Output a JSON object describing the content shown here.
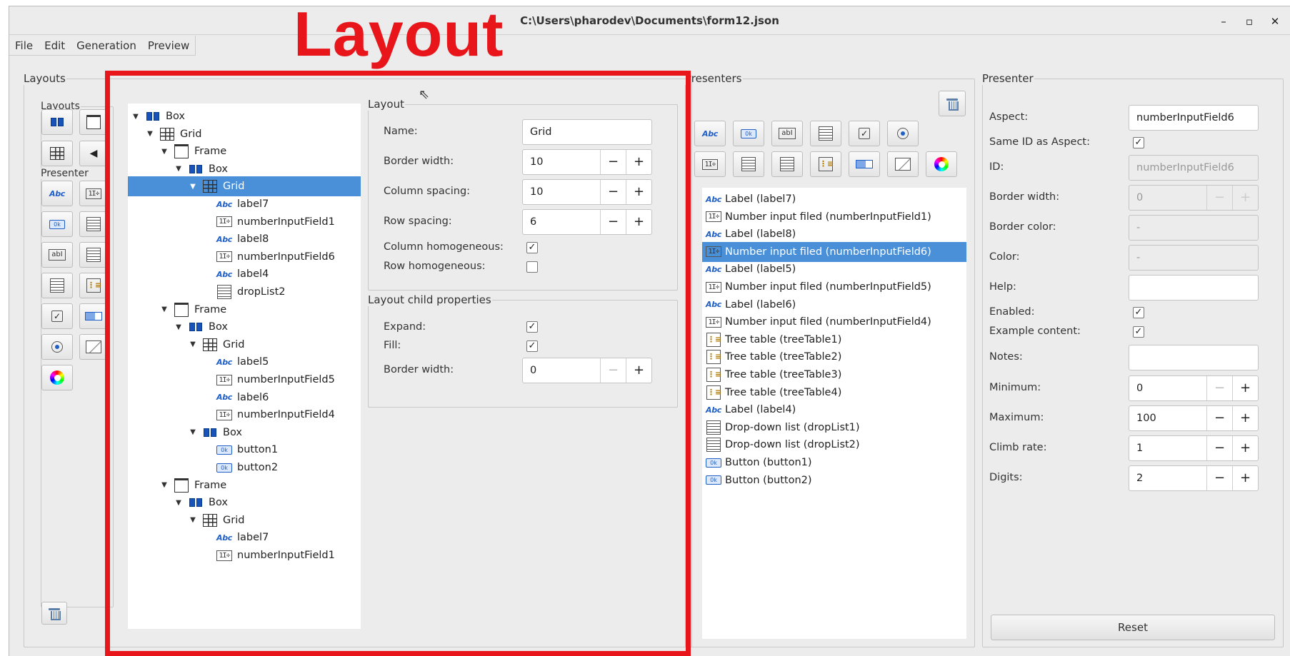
{
  "window": {
    "title": "C:\\Users\\pharodev\\Documents\\form12.json",
    "minimize": "–",
    "maximize": "▫",
    "close": "✕"
  },
  "menu": [
    "File",
    "Edit",
    "Generation",
    "Preview"
  ],
  "annotation": {
    "text": "Layout",
    "color": "#e8161b"
  },
  "layouts_panel": {
    "title": "Layouts",
    "layouts_group": "Layouts",
    "presenter_group": "Presenter"
  },
  "tree": [
    {
      "label": "Box",
      "icon": "box-icon",
      "depth": 0,
      "expanded": true
    },
    {
      "label": "Grid",
      "icon": "grid-icon",
      "depth": 1,
      "expanded": true
    },
    {
      "label": "Frame",
      "icon": "frame-icon",
      "depth": 2,
      "expanded": true
    },
    {
      "label": "Box",
      "icon": "box-icon",
      "depth": 3,
      "expanded": true
    },
    {
      "label": "Grid",
      "icon": "grid-icon",
      "depth": 4,
      "expanded": true,
      "selected": true
    },
    {
      "label": "label7",
      "icon": "label-icon",
      "depth": 5
    },
    {
      "label": "numberInputField1",
      "icon": "number-input-icon",
      "depth": 5
    },
    {
      "label": "label8",
      "icon": "label-icon",
      "depth": 5
    },
    {
      "label": "numberInputField6",
      "icon": "number-input-icon",
      "depth": 5
    },
    {
      "label": "label4",
      "icon": "label-icon",
      "depth": 5
    },
    {
      "label": "dropList2",
      "icon": "drop-list-icon",
      "depth": 5
    },
    {
      "label": "Frame",
      "icon": "frame-icon",
      "depth": 2,
      "expanded": true
    },
    {
      "label": "Box",
      "icon": "box-icon",
      "depth": 3,
      "expanded": true
    },
    {
      "label": "Grid",
      "icon": "grid-icon",
      "depth": 4,
      "expanded": true
    },
    {
      "label": "label5",
      "icon": "label-icon",
      "depth": 5
    },
    {
      "label": "numberInputField5",
      "icon": "number-input-icon",
      "depth": 5
    },
    {
      "label": "label6",
      "icon": "label-icon",
      "depth": 5
    },
    {
      "label": "numberInputField4",
      "icon": "number-input-icon",
      "depth": 5
    },
    {
      "label": "Box",
      "icon": "box-icon",
      "depth": 4,
      "expanded": true
    },
    {
      "label": "button1",
      "icon": "button-icon",
      "depth": 5
    },
    {
      "label": "button2",
      "icon": "button-icon",
      "depth": 5
    },
    {
      "label": "Frame",
      "icon": "frame-icon",
      "depth": 2,
      "expanded": true
    },
    {
      "label": "Box",
      "icon": "box-icon",
      "depth": 3,
      "expanded": true
    },
    {
      "label": "Grid",
      "icon": "grid-icon",
      "depth": 4,
      "expanded": true
    },
    {
      "label": "label7",
      "icon": "label-icon",
      "depth": 5
    },
    {
      "label": "numberInputField1",
      "icon": "number-input-icon",
      "depth": 5
    }
  ],
  "layout_props": {
    "title": "Layout",
    "name_label": "Name:",
    "name_value": "Grid",
    "border_width_label": "Border width:",
    "border_width_value": "10",
    "column_spacing_label": "Column spacing:",
    "column_spacing_value": "10",
    "row_spacing_label": "Row spacing:",
    "row_spacing_value": "6",
    "column_homogeneous_label": "Column homogeneous:",
    "column_homogeneous_checked": true,
    "row_homogeneous_label": "Row homogeneous:",
    "row_homogeneous_checked": false
  },
  "child_props": {
    "title": "Layout child properties",
    "expand_label": "Expand:",
    "expand_checked": true,
    "fill_label": "Fill:",
    "fill_checked": true,
    "border_width_label": "Border width:",
    "border_width_value": "0"
  },
  "presenters": {
    "title": "Presenters",
    "items": [
      {
        "label": "Label (label7)",
        "icon": "label-icon"
      },
      {
        "label": "Number input filed (numberInputField1)",
        "icon": "number-input-icon"
      },
      {
        "label": "Label (label8)",
        "icon": "label-icon"
      },
      {
        "label": "Number input filed (numberInputField6)",
        "icon": "number-input-icon",
        "selected": true
      },
      {
        "label": "Label (label5)",
        "icon": "label-icon"
      },
      {
        "label": "Number input filed (numberInputField5)",
        "icon": "number-input-icon"
      },
      {
        "label": "Label (label6)",
        "icon": "label-icon"
      },
      {
        "label": "Number input filed (numberInputField4)",
        "icon": "number-input-icon"
      },
      {
        "label": "Tree table (treeTable1)",
        "icon": "tree-table-icon"
      },
      {
        "label": "Tree table (treeTable2)",
        "icon": "tree-table-icon"
      },
      {
        "label": "Tree table (treeTable3)",
        "icon": "tree-table-icon"
      },
      {
        "label": "Tree table (treeTable4)",
        "icon": "tree-table-icon"
      },
      {
        "label": "Label (label4)",
        "icon": "label-icon"
      },
      {
        "label": "Drop-down list (dropList1)",
        "icon": "drop-list-icon"
      },
      {
        "label": "Drop-down list (dropList2)",
        "icon": "drop-list-icon"
      },
      {
        "label": "Button (button1)",
        "icon": "button-icon"
      },
      {
        "label": "Button (button2)",
        "icon": "button-icon"
      }
    ]
  },
  "presenter": {
    "title": "Presenter",
    "aspect_label": "Aspect:",
    "aspect_value": "numberInputField6",
    "same_id_label": "Same ID as Aspect:",
    "same_id_checked": true,
    "id_label": "ID:",
    "id_value": "numberInputField6",
    "border_width_label": "Border width:",
    "border_width_value": "0",
    "border_color_label": "Border color:",
    "border_color_value": "-",
    "color_label": "Color:",
    "color_value": "-",
    "help_label": "Help:",
    "help_value": "",
    "enabled_label": "Enabled:",
    "enabled_checked": true,
    "example_label": "Example content:",
    "example_checked": true,
    "notes_label": "Notes:",
    "notes_value": "",
    "minimum_label": "Minimum:",
    "minimum_value": "0",
    "maximum_label": "Maximum:",
    "maximum_value": "100",
    "climb_label": "Climb rate:",
    "climb_value": "1",
    "digits_label": "Digits:",
    "digits_value": "2",
    "reset_label": "Reset"
  },
  "glyphs": {
    "abc": "Abc",
    "ok": "0k",
    "num": "1I÷",
    "abI": "abI",
    "check": "✓",
    "minus": "−",
    "plus": "+",
    "tree": "⋮≡",
    "expander": "▼"
  }
}
